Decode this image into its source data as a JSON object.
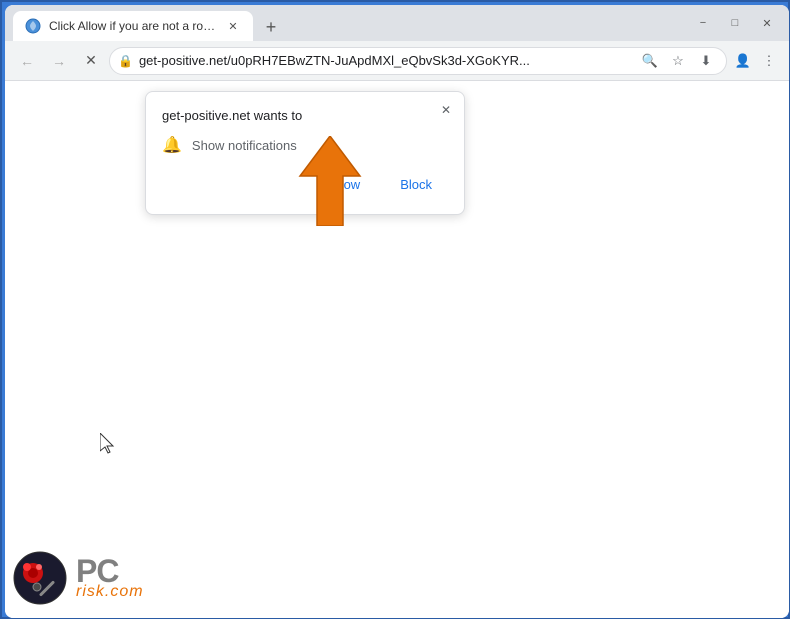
{
  "browser": {
    "tab": {
      "title": "Click Allow if you are not a robot",
      "favicon": "🔵"
    },
    "new_tab_label": "+",
    "window_controls": {
      "minimize": "−",
      "maximize": "□",
      "close": "✕"
    },
    "nav": {
      "back": "←",
      "forward": "→",
      "close": "✕",
      "url": "get-positive.net/u0pRH7EBwZTN-JuApdMXl_eQbvSk3d-XGoKYR...",
      "search_icon": "🔍",
      "star_icon": "☆",
      "profile_icon": "👤",
      "menu_icon": "⋮",
      "download_icon": "⬇"
    },
    "popup": {
      "title": "get-positive.net wants to",
      "permission_text": "Show notifications",
      "allow_button": "Allow",
      "block_button": "Block",
      "close_icon": "✕"
    }
  },
  "logo": {
    "pc_text": "PC",
    "risk_text": "risk.com"
  }
}
